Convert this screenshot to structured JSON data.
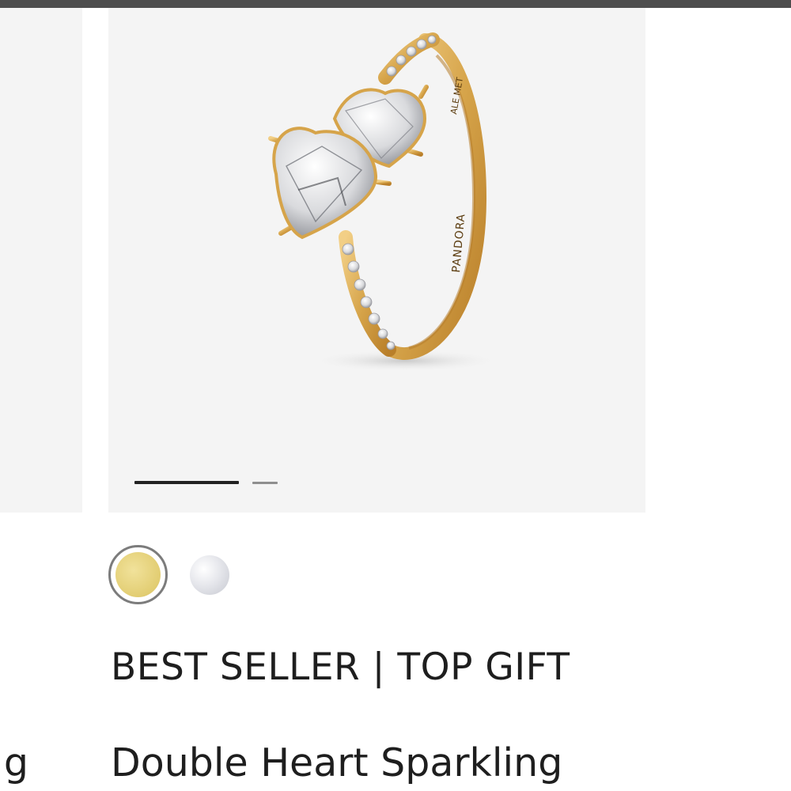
{
  "carousel": {
    "active_index": 1,
    "total_slides": 2
  },
  "product_image": {
    "engraving_brand": "PANDORA",
    "engraving_hallmark": "ALE MET",
    "metal_color": "#d6a44a",
    "background_color": "#f4f4f4"
  },
  "color_swatches": [
    {
      "name": "Gold",
      "color": "#e6d27a",
      "selected": true
    },
    {
      "name": "Silver",
      "color": "#dfe0e6",
      "selected": false
    }
  ],
  "product": {
    "badge": "BEST SELLER | TOP GIFT",
    "title": "Double Heart Sparkling"
  },
  "previous_product": {
    "title_fragment": "g"
  }
}
